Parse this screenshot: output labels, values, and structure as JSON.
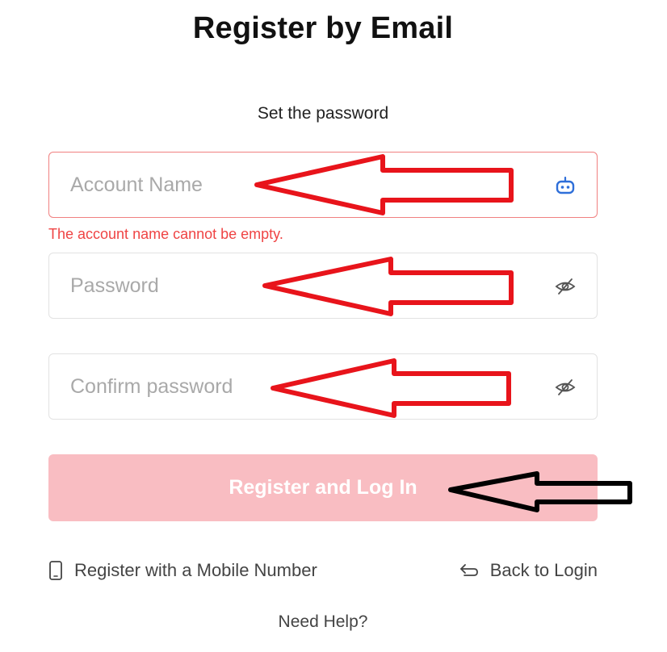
{
  "page": {
    "title": "Register by Email",
    "subtitle": "Set the password"
  },
  "form": {
    "account": {
      "placeholder": "Account Name",
      "value": "",
      "icon": "bot-icon",
      "error": "The account name cannot be empty."
    },
    "password": {
      "placeholder": "Password",
      "value": "",
      "icon": "eye-off-icon"
    },
    "confirm": {
      "placeholder": "Confirm password",
      "value": "",
      "icon": "eye-off-icon"
    },
    "submit_label": "Register and Log In"
  },
  "links": {
    "mobile": "Register with a Mobile Number",
    "back": "Back to Login",
    "help": "Need Help?"
  },
  "colors": {
    "error": "#ef4444",
    "submit_bg": "#f9bdc2",
    "icon_blue": "#2f6fd9",
    "annotation_red": "#e8141b",
    "annotation_black": "#000000"
  }
}
